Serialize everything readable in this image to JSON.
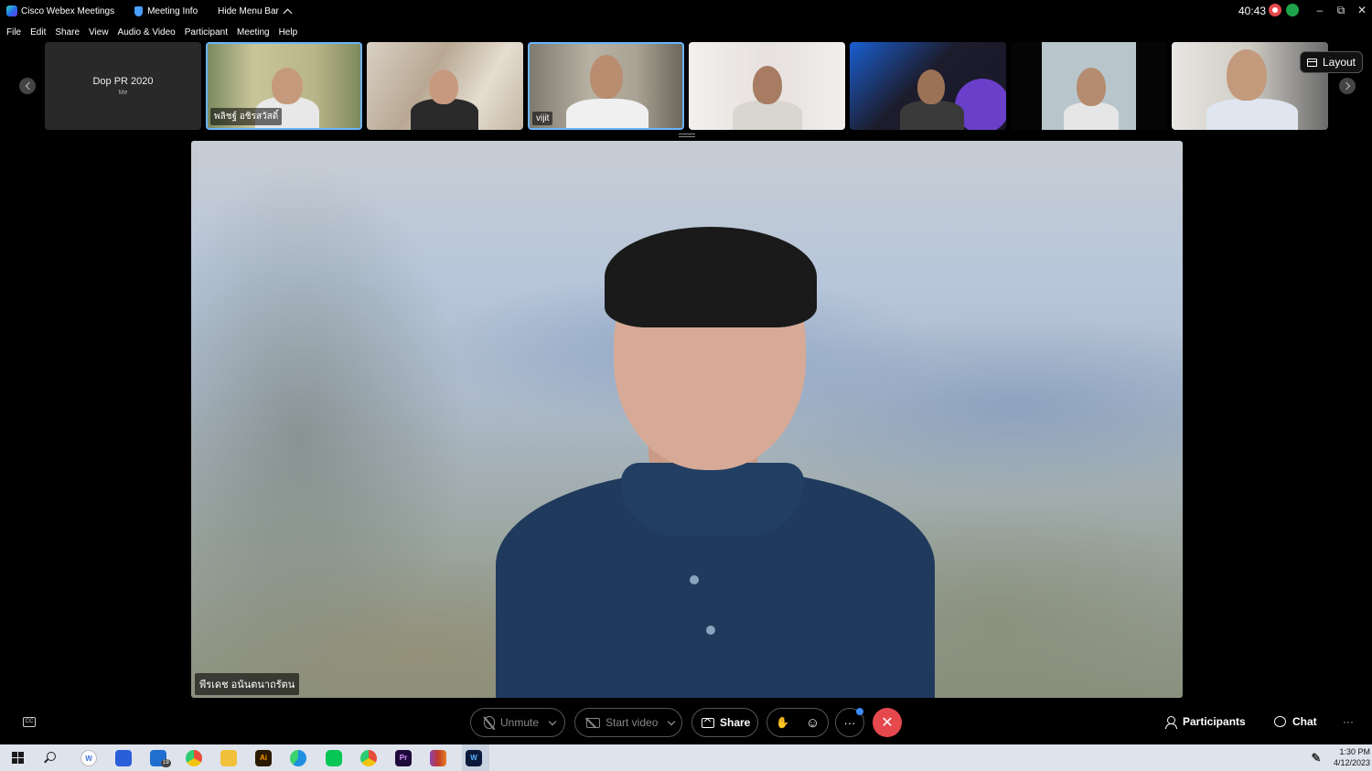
{
  "titlebar": {
    "app_name": "Cisco Webex Meetings",
    "meeting_info": "Meeting Info",
    "hide_menu": "Hide Menu Bar",
    "timer": "40:43",
    "minimize": "–",
    "restore": "⧉",
    "close": "✕"
  },
  "menu": [
    "File",
    "Edit",
    "Share",
    "View",
    "Audio & Video",
    "Participant",
    "Meeting",
    "Help"
  ],
  "filmstrip": {
    "self_name": "Dop PR 2020",
    "self_sub": "Me",
    "tiles": [
      {
        "name": "พลิชฐ์ อชิรสวัสดิ์"
      },
      {
        "name": ""
      },
      {
        "name": "vijit"
      },
      {
        "name": ""
      },
      {
        "name": ""
      },
      {
        "name": ""
      },
      {
        "name": ""
      }
    ],
    "layout_label": "Layout"
  },
  "main_video": {
    "speaker_name": "พีรเดช อนันตนาถรัตน"
  },
  "controls": {
    "cc": "CC",
    "unmute": "Unmute",
    "start_video": "Start video",
    "share": "Share",
    "raise_hand": "✋",
    "reactions": "☺",
    "more": "···",
    "end": "✕",
    "participants": "Participants",
    "chat": "Chat",
    "overflow": "···"
  },
  "taskbar": {
    "time": "1:30 PM",
    "date": "4/12/2023",
    "mail_badge": "19",
    "illustrator_label": "Ai",
    "premiere_label": "Pr",
    "webex_label": "W"
  },
  "colors": {
    "accent": "#6ab4ff",
    "end_call": "#e5484d",
    "taskbar": "#dfe4ec"
  }
}
